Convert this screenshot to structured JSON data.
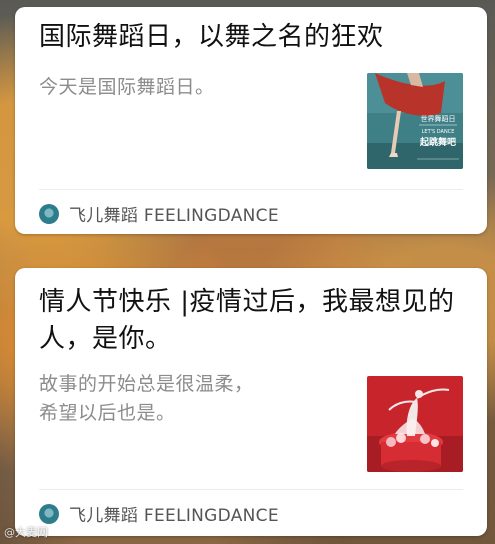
{
  "articles": [
    {
      "title": "国际舞蹈日，以舞之名的狂欢",
      "summary": "今天是国际舞蹈日。",
      "source": "飞儿舞蹈 FEELINGDANCE",
      "thumb": {
        "line1": "世界舞蹈日",
        "line2": "LET'S DANCE",
        "line3": "起跳舞吧",
        "colors": {
          "bg": "#3f7f86",
          "dress": "#b8342a"
        }
      }
    },
    {
      "title": "情人节快乐 |疫情过后，我最想见的人，是你。",
      "summary_lines": [
        "故事的开始总是很温柔，",
        "希望以后也是。"
      ],
      "source": "飞儿舞蹈 FEELINGDANCE",
      "thumb": {
        "colors": {
          "bg": "#c8242c",
          "figure": "#f3e6e6"
        }
      }
    }
  ],
  "watermark": "@大麦网"
}
